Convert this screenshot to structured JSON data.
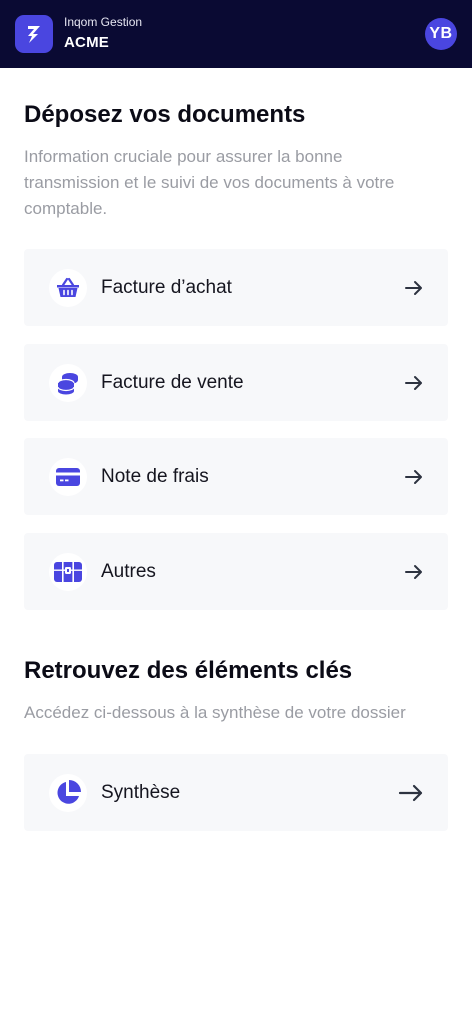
{
  "header": {
    "subtitle": "Inqom Gestion",
    "title": "ACME",
    "avatar_initials": "YB",
    "logo_icon": "bolt-logo-icon",
    "accent_color": "#4a46e0",
    "background_color": "#0a0a33"
  },
  "documents": {
    "title": "Déposez vos documents",
    "description": "Information cruciale pour assurer la bonne transmission et le suivi de vos documents à votre comptable.",
    "items": [
      {
        "label": "Facture d’achat",
        "icon": "shopping-basket-icon"
      },
      {
        "label": "Facture de vente",
        "icon": "coins-stack-icon"
      },
      {
        "label": "Note de frais",
        "icon": "credit-card-icon"
      },
      {
        "label": "Autres",
        "icon": "treasure-chest-icon"
      }
    ]
  },
  "key_elements": {
    "title": "Retrouvez des éléments clés",
    "description": "Accédez ci-dessous à la synthèse de votre dossier",
    "items": [
      {
        "label": "Synthèse",
        "icon": "pie-chart-icon"
      }
    ]
  }
}
